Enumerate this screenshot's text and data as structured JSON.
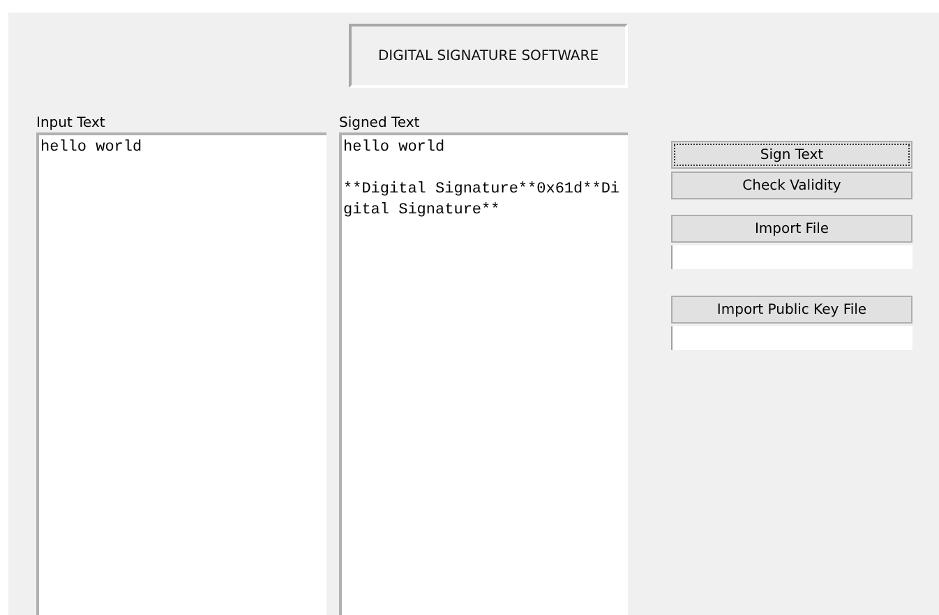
{
  "window": {
    "title": "DIGITAL SIGNATURE SOFTWARE"
  },
  "panels": [
    {
      "label": "Input Text",
      "value": "hello world"
    },
    {
      "label": "Signed Text",
      "value": "hello world\n\n**Digital Signature**0x61d**Digital Signature**"
    }
  ],
  "actions": [
    {
      "kind": "button",
      "label": "Sign Text",
      "focused": true
    },
    {
      "kind": "button",
      "label": "Check Validity",
      "focused": false
    },
    {
      "kind": "gap"
    },
    {
      "kind": "button",
      "label": "Import File",
      "focused": false
    },
    {
      "kind": "field"
    },
    {
      "kind": "gap"
    },
    {
      "kind": "button",
      "label": "Import Public Key File",
      "focused": false
    },
    {
      "kind": "field"
    }
  ]
}
